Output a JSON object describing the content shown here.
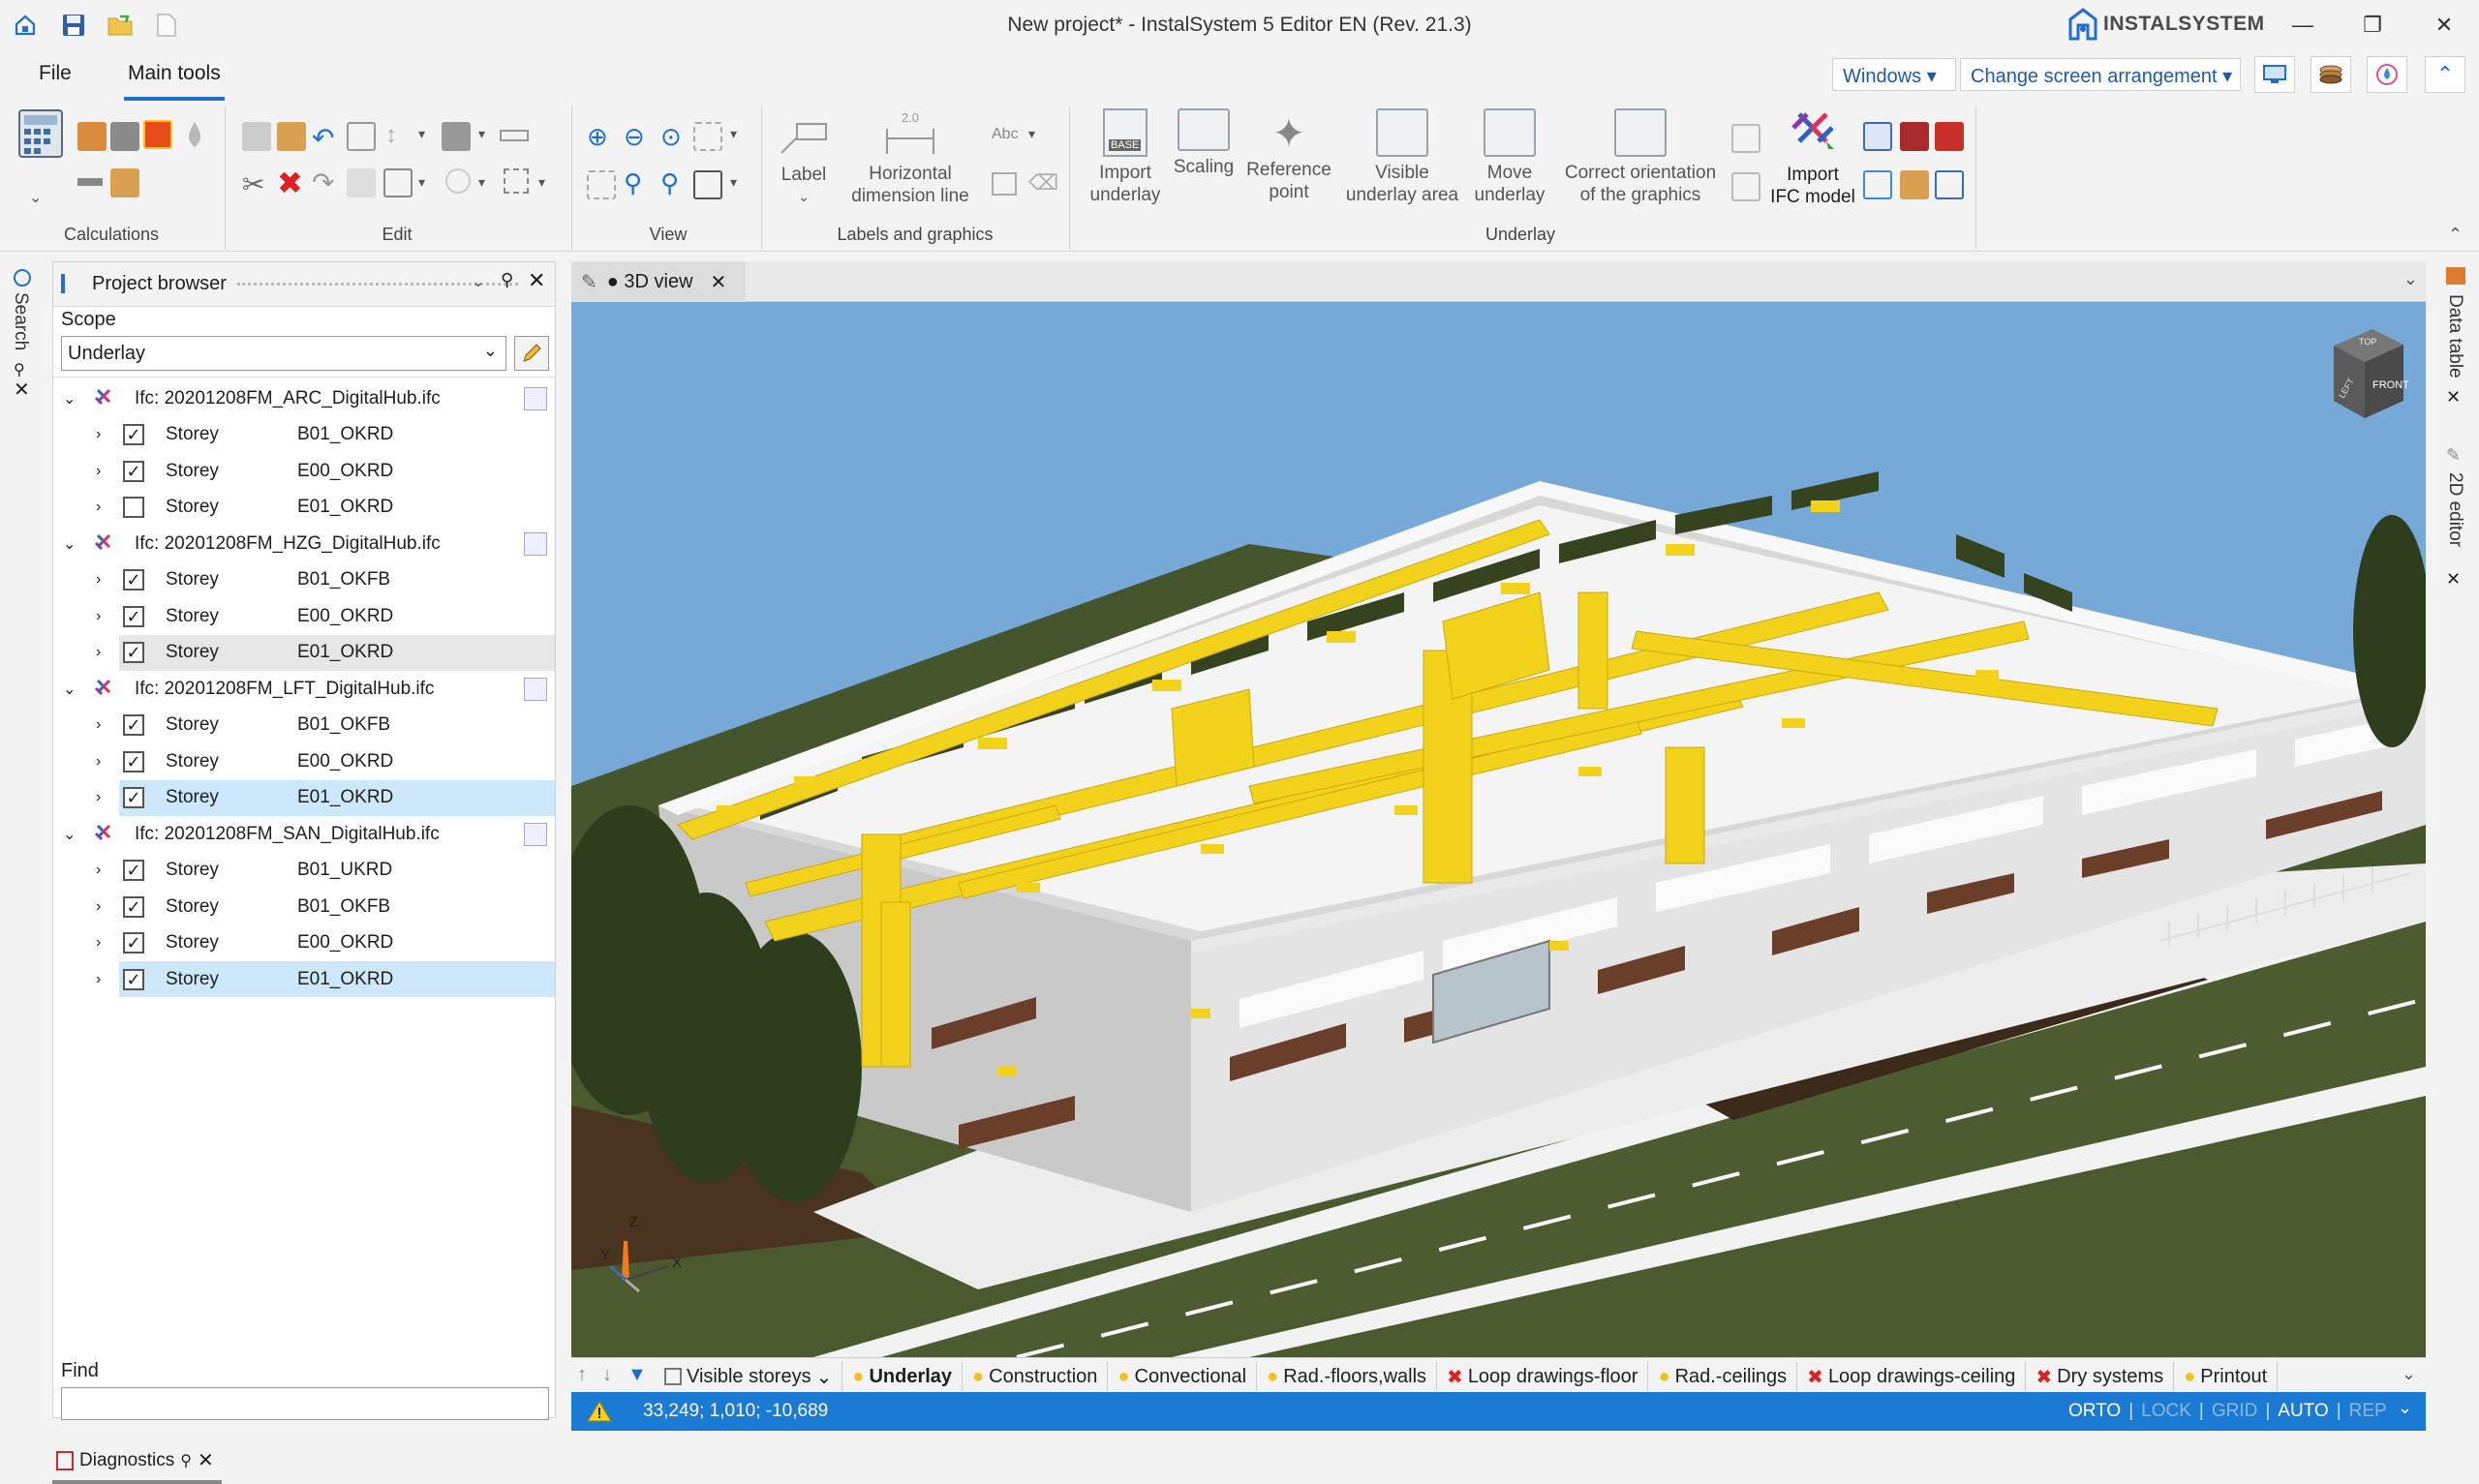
{
  "window": {
    "title": "New project* - InstalSystem 5 Editor EN (Rev. 21.3)",
    "brand": "INSTALSYSTEM"
  },
  "menu": {
    "file": "File",
    "main_tools": "Main tools",
    "windows": "Windows",
    "change_screen": "Change screen arrangement"
  },
  "ribbon": {
    "groups": {
      "calculations": "Calculations",
      "edit": "Edit",
      "view": "View",
      "labels": "Labels and graphics",
      "underlay": "Underlay"
    },
    "label": "Label",
    "hdim_1": "Horizontal",
    "hdim_2": "dimension line",
    "abc": "Abc",
    "two_zero": "2.0",
    "base": "BASE",
    "import_underlay_1": "Import",
    "import_underlay_2": "underlay",
    "scaling": "Scaling",
    "refpoint_1": "Reference",
    "refpoint_2": "point",
    "visible_area_1": "Visible",
    "visible_area_2": "underlay area",
    "move_underlay_1": "Move",
    "move_underlay_2": "underlay",
    "correct_1": "Correct orientation",
    "correct_2": "of the graphics",
    "import_ifc_1": "Import",
    "import_ifc_2": "IFC model"
  },
  "side": {
    "search": "Search",
    "data_table": "Data table",
    "editor_2d": "2D editor"
  },
  "project_browser": {
    "title": "Project browser",
    "scope_label": "Scope",
    "scope_value": "Underlay",
    "find_label": "Find",
    "files": [
      {
        "name": "Ifc: 20201208FM_ARC_DigitalHub.ifc",
        "storeys": [
          {
            "label": "Storey",
            "code": "B01_OKRD",
            "checked": true
          },
          {
            "label": "Storey",
            "code": "E00_OKRD",
            "checked": true
          },
          {
            "label": "Storey",
            "code": "E01_OKRD",
            "checked": false
          }
        ]
      },
      {
        "name": "Ifc: 20201208FM_HZG_DigitalHub.ifc",
        "storeys": [
          {
            "label": "Storey",
            "code": "B01_OKFB",
            "checked": true
          },
          {
            "label": "Storey",
            "code": "E00_OKRD",
            "checked": true
          },
          {
            "label": "Storey",
            "code": "E01_OKRD",
            "checked": true
          }
        ]
      },
      {
        "name": "Ifc: 20201208FM_LFT_DigitalHub.ifc",
        "storeys": [
          {
            "label": "Storey",
            "code": "B01_OKFB",
            "checked": true
          },
          {
            "label": "Storey",
            "code": "E00_OKRD",
            "checked": true
          },
          {
            "label": "Storey",
            "code": "E01_OKRD",
            "checked": true
          }
        ]
      },
      {
        "name": "Ifc: 20201208FM_SAN_DigitalHub.ifc",
        "storeys": [
          {
            "label": "Storey",
            "code": "B01_UKRD",
            "checked": true
          },
          {
            "label": "Storey",
            "code": "B01_OKFB",
            "checked": true
          },
          {
            "label": "Storey",
            "code": "E00_OKRD",
            "checked": true
          },
          {
            "label": "Storey",
            "code": "E01_OKRD",
            "checked": true
          }
        ]
      }
    ]
  },
  "view": {
    "tab_label": "● 3D view",
    "cube_top": "TOP",
    "cube_front": "FRONT",
    "cube_left": "LEFT",
    "axis_x": "X",
    "axis_y": "Y",
    "axis_z": "Z"
  },
  "layer_tabs": {
    "visible_storeys": "Visible storeys",
    "items": [
      {
        "label": "Underlay",
        "icon": "bulb-icon",
        "bold": true
      },
      {
        "label": "Construction",
        "icon": "bulb-icon",
        "bold": false
      },
      {
        "label": "Convectional",
        "icon": "bulb-icon",
        "bold": false
      },
      {
        "label": "Rad.-floors,walls",
        "icon": "bulb-icon",
        "bold": false
      },
      {
        "label": "Loop drawings-floor",
        "icon": "x-icon",
        "bold": false
      },
      {
        "label": "Rad.-ceilings",
        "icon": "bulb-icon",
        "bold": false
      },
      {
        "label": "Loop drawings-ceiling",
        "icon": "x-icon",
        "bold": false
      },
      {
        "label": "Dry systems",
        "icon": "x-icon",
        "bold": false
      },
      {
        "label": "Printout",
        "icon": "bulb-icon",
        "bold": false
      }
    ]
  },
  "status": {
    "coords": "33,249; 1,010; -10,689",
    "orto": "ORTO",
    "lock": "LOCK",
    "grid": "GRID",
    "auto": "AUTO",
    "rep": "REP"
  },
  "diagnostics": "Diagnostics",
  "colors": {
    "accent": "#1b7ad4",
    "selection": "#cde8fb",
    "duct_yellow": "#f2d21a",
    "sky": "#6ea4d8",
    "grass": "#46562c"
  }
}
